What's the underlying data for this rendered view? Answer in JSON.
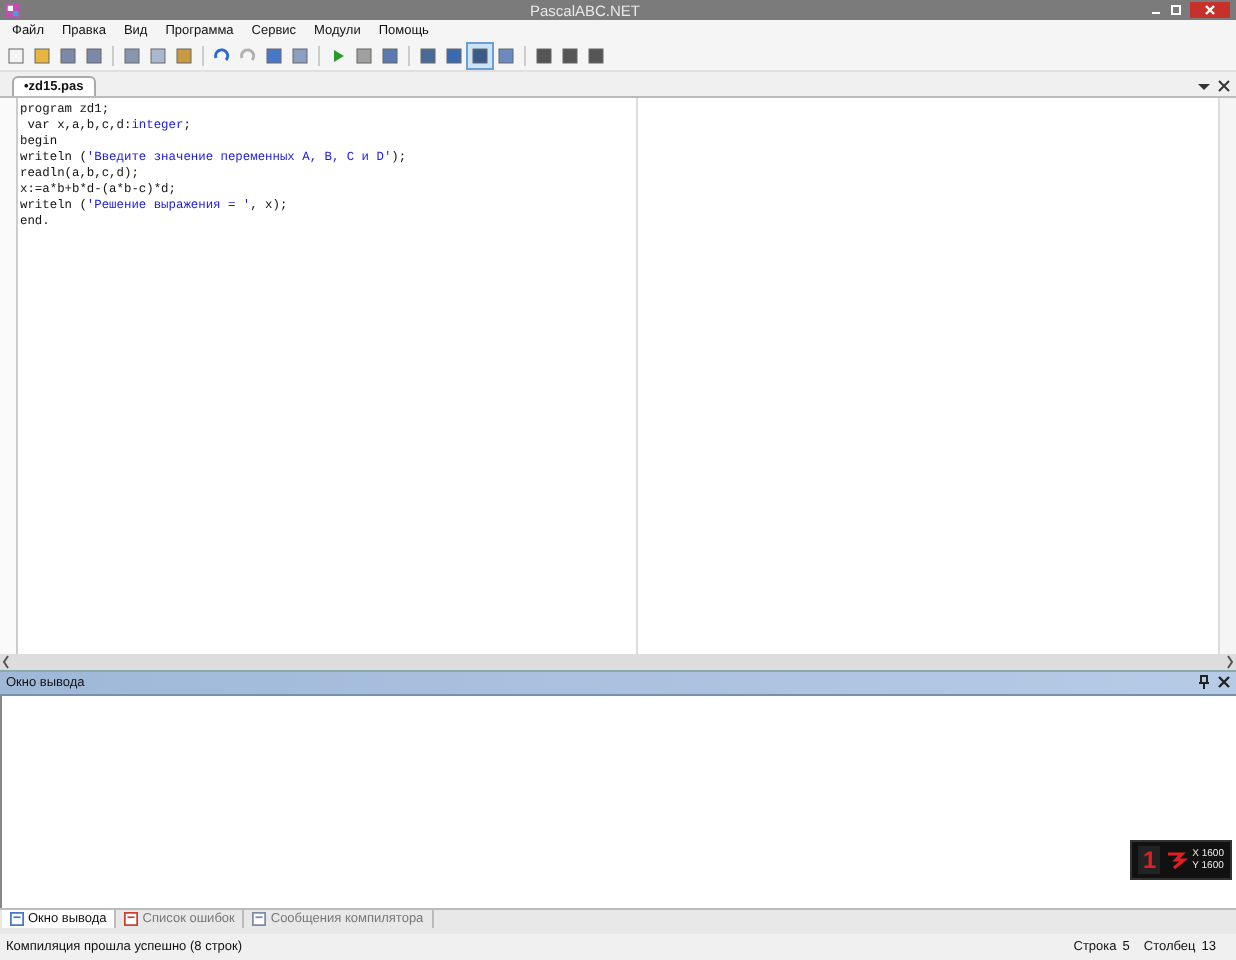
{
  "window": {
    "title": "PascalABC.NET"
  },
  "menu": [
    "Файл",
    "Правка",
    "Вид",
    "Программа",
    "Сервис",
    "Модули",
    "Помощь"
  ],
  "toolbar": [
    {
      "kind": "new",
      "selected": false
    },
    {
      "kind": "open",
      "selected": false
    },
    {
      "kind": "save",
      "selected": false
    },
    {
      "kind": "saveall",
      "selected": false
    },
    {
      "kind": "sep"
    },
    {
      "kind": "cut",
      "selected": false
    },
    {
      "kind": "copy",
      "selected": false
    },
    {
      "kind": "paste",
      "selected": false
    },
    {
      "kind": "sep"
    },
    {
      "kind": "undo",
      "selected": false
    },
    {
      "kind": "redo",
      "selected": false
    },
    {
      "kind": "find",
      "selected": false
    },
    {
      "kind": "replace",
      "selected": false
    },
    {
      "kind": "sep"
    },
    {
      "kind": "run",
      "selected": false
    },
    {
      "kind": "stop",
      "selected": false
    },
    {
      "kind": "window",
      "selected": false
    },
    {
      "kind": "sep"
    },
    {
      "kind": "comment",
      "selected": false
    },
    {
      "kind": "goto",
      "selected": false
    },
    {
      "kind": "console",
      "selected": true
    },
    {
      "kind": "doc",
      "selected": false
    },
    {
      "kind": "sep"
    },
    {
      "kind": "debug",
      "selected": false
    },
    {
      "kind": "debug",
      "selected": false
    },
    {
      "kind": "debug",
      "selected": false
    }
  ],
  "editor_tabs": [
    {
      "label": "•zd15.pas",
      "selected": true
    }
  ],
  "code": [
    [
      {
        "kind": "plain",
        "text": "program zd1;"
      }
    ],
    [
      {
        "kind": "plain",
        "text": " var x,a,b,c,d:"
      },
      {
        "kind": "type",
        "text": "integer"
      },
      {
        "kind": "plain",
        "text": ";"
      }
    ],
    [
      {
        "kind": "plain",
        "text": "begin"
      }
    ],
    [
      {
        "kind": "plain",
        "text": "writeln ("
      },
      {
        "kind": "string",
        "text": "'Введите значение переменных A, B, C и D'"
      },
      {
        "kind": "plain",
        "text": ");"
      }
    ],
    [
      {
        "kind": "plain",
        "text": "readln(a,b,c,d);"
      }
    ],
    [
      {
        "kind": "plain",
        "text": "x:=a*b+b*d-(a*b-c)*d;"
      }
    ],
    [
      {
        "kind": "plain",
        "text": "writeln ("
      },
      {
        "kind": "string",
        "text": "'Решение выражения = '"
      },
      {
        "kind": "plain",
        "text": ", x);"
      }
    ],
    [
      {
        "kind": "plain",
        "text": "end."
      }
    ]
  ],
  "output_panel": {
    "title": "Окно вывода"
  },
  "overlay": {
    "digit": "1",
    "x": "X 1600",
    "y": "Y 1600"
  },
  "bottom_tabs": [
    {
      "label": "Окно вывода",
      "kind": "output",
      "selected": true
    },
    {
      "label": "Список ошибок",
      "kind": "errors",
      "selected": false
    },
    {
      "label": "Сообщения компилятора",
      "kind": "messages",
      "selected": false
    }
  ],
  "status_bar": {
    "message": "Компиляция прошла успешно (8 строк)",
    "row_label": "Строка",
    "row": "5",
    "col_label": "Столбец",
    "col": "13"
  }
}
